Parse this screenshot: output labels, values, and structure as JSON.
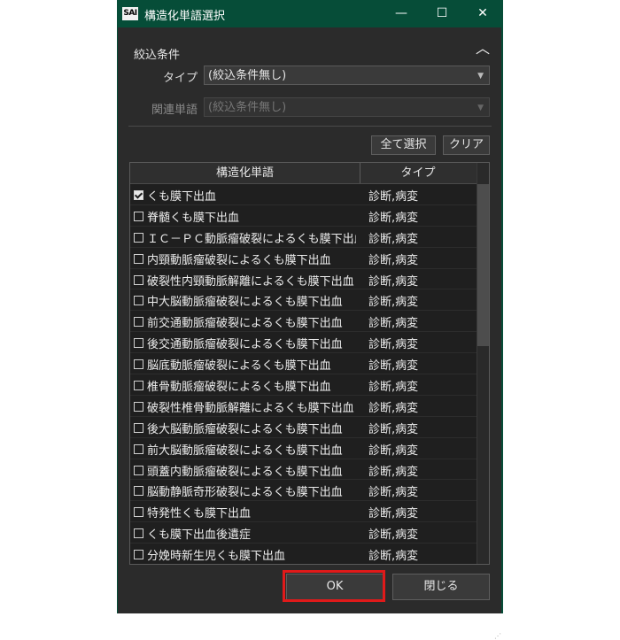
{
  "window": {
    "icon_text": "SAI",
    "title": "構造化単語選択",
    "minimize": "—",
    "maximize": "☐",
    "close": "✕"
  },
  "filter": {
    "section_label": "絞込条件",
    "type_label": "タイプ",
    "type_value": "(絞込条件無し)",
    "related_label": "関連単語",
    "related_value": "(絞込条件無し)"
  },
  "buttons": {
    "select_all": "全て選択",
    "clear": "クリア",
    "ok": "OK",
    "close": "閉じる"
  },
  "table": {
    "columns": [
      "構造化単語",
      "タイプ"
    ],
    "rows": [
      {
        "term": "くも膜下出血",
        "type": "診断,病変",
        "checked": true
      },
      {
        "term": "脊髄くも膜下出血",
        "type": "診断,病変",
        "checked": false
      },
      {
        "term": "ＩＣ－ＰＣ動脈瘤破裂によるくも膜下出血",
        "type": "診断,病変",
        "checked": false
      },
      {
        "term": "内頸動脈瘤破裂によるくも膜下出血",
        "type": "診断,病変",
        "checked": false
      },
      {
        "term": "破裂性内頸動脈解離によるくも膜下出血",
        "type": "診断,病変",
        "checked": false
      },
      {
        "term": "中大脳動脈瘤破裂によるくも膜下出血",
        "type": "診断,病変",
        "checked": false
      },
      {
        "term": "前交通動脈瘤破裂によるくも膜下出血",
        "type": "診断,病変",
        "checked": false
      },
      {
        "term": "後交通動脈瘤破裂によるくも膜下出血",
        "type": "診断,病変",
        "checked": false
      },
      {
        "term": "脳底動脈瘤破裂によるくも膜下出血",
        "type": "診断,病変",
        "checked": false
      },
      {
        "term": "椎骨動脈瘤破裂によるくも膜下出血",
        "type": "診断,病変",
        "checked": false
      },
      {
        "term": "破裂性椎骨動脈解離によるくも膜下出血",
        "type": "診断,病変",
        "checked": false
      },
      {
        "term": "後大脳動脈瘤破裂によるくも膜下出血",
        "type": "診断,病変",
        "checked": false
      },
      {
        "term": "前大脳動脈瘤破裂によるくも膜下出血",
        "type": "診断,病変",
        "checked": false
      },
      {
        "term": "頭蓋内動脈瘤破裂によるくも膜下出血",
        "type": "診断,病変",
        "checked": false
      },
      {
        "term": "脳動静脈奇形破裂によるくも膜下出血",
        "type": "診断,病変",
        "checked": false
      },
      {
        "term": "特発性くも膜下出血",
        "type": "診断,病変",
        "checked": false
      },
      {
        "term": "くも膜下出血後遺症",
        "type": "診断,病変",
        "checked": false
      },
      {
        "term": "分娩時新生児くも膜下出血",
        "type": "診断,病変",
        "checked": false
      }
    ]
  },
  "colors": {
    "title_bar": "#064d38",
    "client_bg": "#2b2b2b",
    "highlight": "#e01a1a"
  }
}
